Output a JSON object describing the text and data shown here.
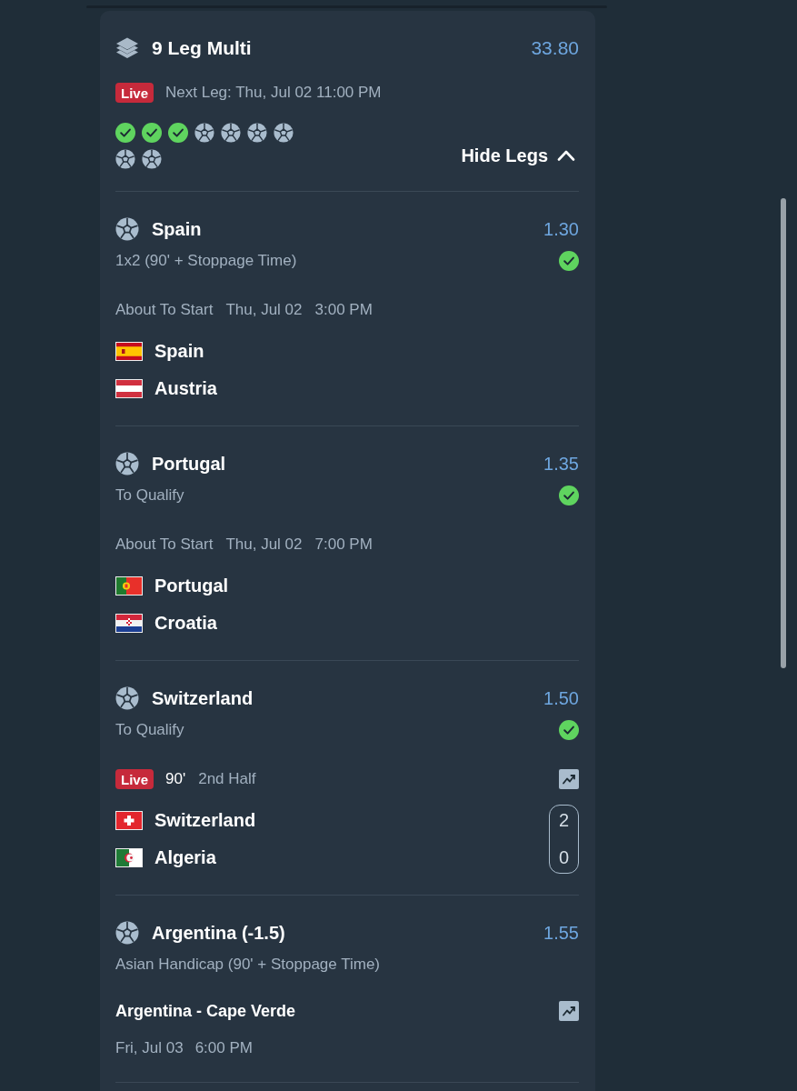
{
  "bet": {
    "title": "9 Leg Multi",
    "odds": "33.80",
    "badge": "Live",
    "next_leg": "Next Leg: Thu, Jul 02 11:00 PM",
    "leg_indicators": [
      {
        "won": true
      },
      {
        "won": true
      },
      {
        "won": true
      },
      {
        "won": false
      },
      {
        "won": false
      },
      {
        "won": false
      },
      {
        "won": false
      },
      {
        "won": false
      },
      {
        "won": false
      }
    ],
    "toggle": {
      "label": "Hide Legs",
      "expanded": true
    }
  },
  "legs": [
    {
      "selection": "Spain",
      "odds": "1.30",
      "market": "1x2 (90' + Stoppage Time)",
      "won": true,
      "event": {
        "kind": "scheduled",
        "status": "About To Start",
        "date": "Thu, Jul 02",
        "time": "3:00 PM",
        "stats": false
      },
      "teams": [
        {
          "name": "Spain",
          "kind": "es"
        },
        {
          "name": "Austria",
          "kind": "at"
        }
      ]
    },
    {
      "selection": "Portugal",
      "odds": "1.35",
      "market": "To Qualify",
      "won": true,
      "event": {
        "kind": "scheduled",
        "status": "About To Start",
        "date": "Thu, Jul 02",
        "time": "7:00 PM",
        "stats": false
      },
      "teams": [
        {
          "name": "Portugal",
          "kind": "pt"
        },
        {
          "name": "Croatia",
          "kind": "hr"
        }
      ]
    },
    {
      "selection": "Switzerland",
      "odds": "1.50",
      "market": "To Qualify",
      "won": true,
      "event": {
        "kind": "live",
        "badge": "Live",
        "minute": "90'",
        "period": "2nd Half",
        "stats": true
      },
      "teams": [
        {
          "name": "Switzerland",
          "kind": "ch",
          "score": "2"
        },
        {
          "name": "Algeria",
          "kind": "dz",
          "score": "0"
        }
      ]
    },
    {
      "selection": "Argentina (-1.5)",
      "odds": "1.55",
      "market": "Asian Handicap (90' + Stoppage Time)",
      "won": false,
      "event": {
        "kind": "upcoming",
        "title": "Argentina - Cape Verde",
        "date": "Fri, Jul 03",
        "time": "6:00 PM",
        "stats": true
      }
    }
  ]
}
